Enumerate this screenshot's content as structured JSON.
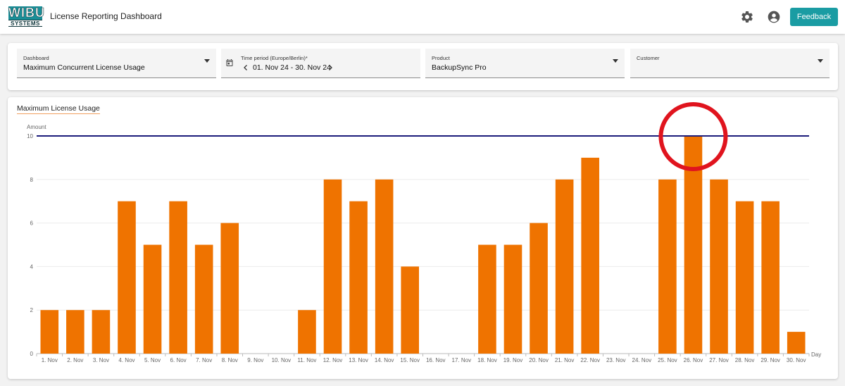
{
  "header": {
    "logo_top": "WIBU",
    "logo_bottom": "SYSTEMS",
    "title": "License Reporting Dashboard",
    "settings_icon": "gear-icon",
    "account_icon": "account-circle-icon",
    "feedback_label": "Feedback"
  },
  "filters": {
    "dashboard": {
      "label": "Dashboard",
      "value": "Maximum Concurrent License Usage"
    },
    "period": {
      "label": "Time period (Europe/Berlin)*",
      "value": "01. Nov 24 - 30. Nov 24"
    },
    "product": {
      "label": "Product",
      "value": "BackupSync Pro"
    },
    "customer": {
      "label": "Customer",
      "value": ""
    }
  },
  "colors": {
    "bar": "#ef7300",
    "limit_line": "#1c1c7a",
    "annotation": "#e0141e",
    "accent": "#1a9ca3"
  },
  "chart_data": {
    "type": "bar",
    "title": "Maximum License Usage",
    "ylabel": "Amount",
    "xlabel": "Day",
    "ylim": [
      0,
      10
    ],
    "yticks": [
      0,
      2,
      4,
      6,
      8,
      10
    ],
    "categories": [
      "1. Nov",
      "2. Nov",
      "3. Nov",
      "4. Nov",
      "5. Nov",
      "6. Nov",
      "7. Nov",
      "8. Nov",
      "9. Nov",
      "10. Nov",
      "11. Nov",
      "12. Nov",
      "13. Nov",
      "14. Nov",
      "15. Nov",
      "16. Nov",
      "17. Nov",
      "18. Nov",
      "19. Nov",
      "20. Nov",
      "21. Nov",
      "22. Nov",
      "23. Nov",
      "24. Nov",
      "25. Nov",
      "26. Nov",
      "27. Nov",
      "28. Nov",
      "29. Nov",
      "30. Nov"
    ],
    "values": [
      2,
      2,
      2,
      7,
      5,
      7,
      5,
      6,
      0,
      0,
      2,
      8,
      7,
      8,
      4,
      0,
      0,
      5,
      5,
      6,
      8,
      9,
      0,
      0,
      8,
      10,
      8,
      7,
      7,
      1
    ],
    "limit": 10,
    "highlighted_category": "26. Nov",
    "grid": true,
    "legend": "none"
  }
}
